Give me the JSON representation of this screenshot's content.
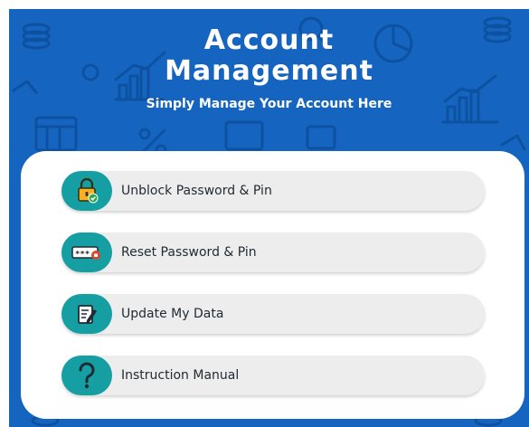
{
  "header": {
    "title": "Account Management",
    "subtitle": "Simply Manage Your Account Here"
  },
  "menu": {
    "items": [
      {
        "label": "Unblock Password & Pin",
        "icon": "padlock-check-icon"
      },
      {
        "label": "Reset Password & Pin",
        "icon": "password-field-icon"
      },
      {
        "label": "Update My Data",
        "icon": "edit-document-icon"
      },
      {
        "label": "Instruction Manual",
        "icon": "question-mark-icon"
      }
    ]
  },
  "colors": {
    "background": "#1565c0",
    "card": "#ffffff",
    "item_background": "#ededed",
    "icon_circle": "#159fa3",
    "text": "#1f2a33"
  }
}
